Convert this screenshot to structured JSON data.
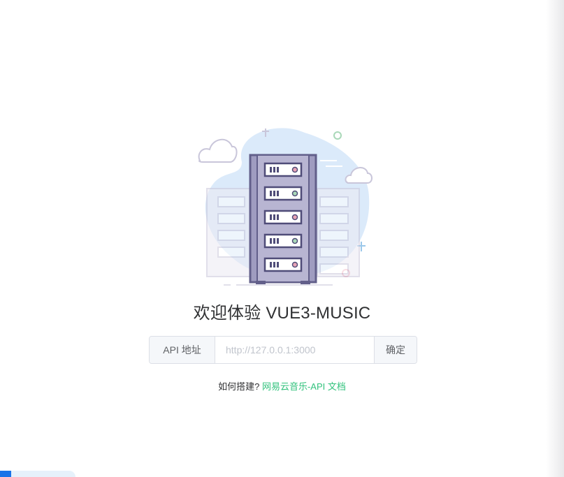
{
  "welcome": {
    "title": "欢迎体验 VUE3-MUSIC"
  },
  "api": {
    "prefix_label": "API 地址",
    "placeholder": "http://127.0.0.1:3000",
    "value": "",
    "confirm_label": "确定"
  },
  "help": {
    "question": "如何搭建?",
    "link_text": "网易云音乐-API 文档"
  },
  "colors": {
    "accent_green": "#31c27c",
    "title_text": "#303133",
    "border": "#dcdfe6",
    "server_purple": "#7b76a6"
  },
  "icons": {
    "illustration": "server-rack-illustration"
  }
}
